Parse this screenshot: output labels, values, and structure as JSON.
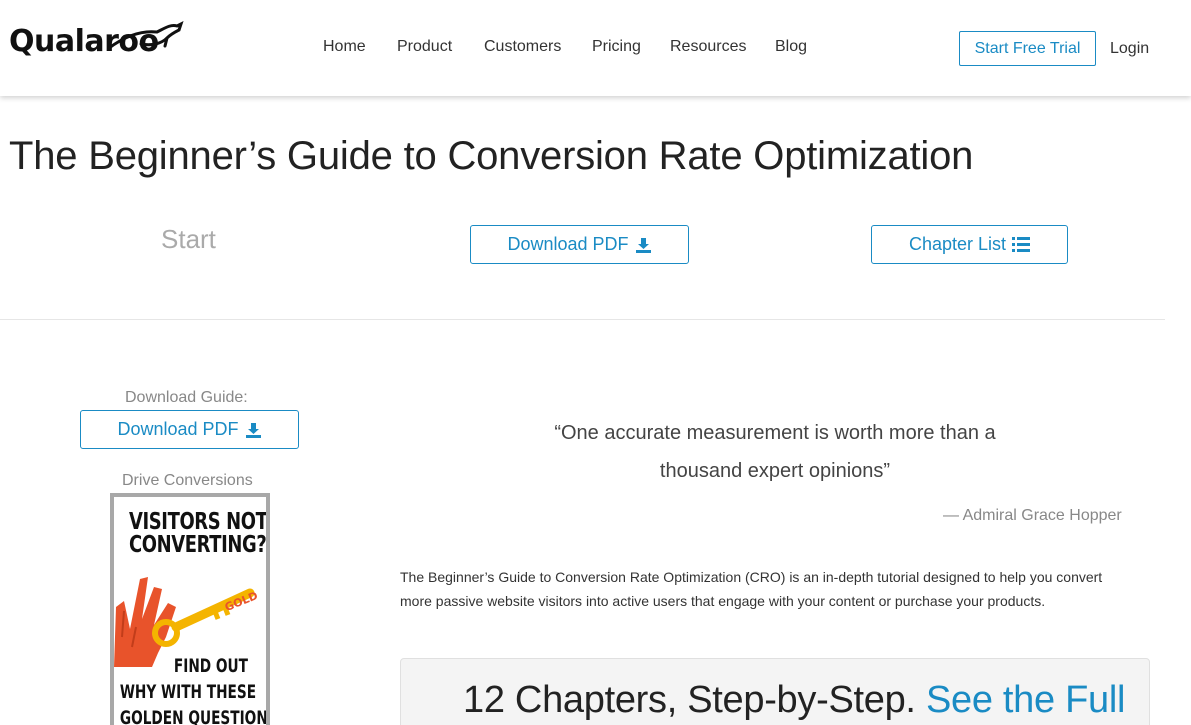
{
  "brand": {
    "logo_text": "Qualaroo",
    "accent_color": "#1a8bc4"
  },
  "nav": {
    "items": [
      {
        "label": "Home"
      },
      {
        "label": "Product"
      },
      {
        "label": "Customers"
      },
      {
        "label": "Pricing"
      },
      {
        "label": "Resources"
      },
      {
        "label": "Blog"
      }
    ],
    "trial_button": "Start Free Trial",
    "login": "Login"
  },
  "page": {
    "title": "The Beginner’s Guide to Conversion Rate Optimization",
    "start_label": "Start",
    "download_pdf_label": "Download PDF",
    "chapter_list_label": "Chapter List"
  },
  "sidebar": {
    "download_heading": "Download Guide:",
    "download_button": "Download PDF",
    "ad_heading": "Drive Conversions",
    "ad": {
      "headline_1": "VISITORS NOT",
      "headline_2": "CONVERTING?",
      "key_tag": "GOLD",
      "footer_1": "FIND OUT",
      "footer_2": "WHY WITH THESE",
      "footer_3": "GOLDEN QUESTIONS."
    }
  },
  "main": {
    "quote_line_1": "“One accurate measurement is worth more than a",
    "quote_line_2": "thousand expert opinions”",
    "attribution": "— Admiral Grace Hopper",
    "intro_line_1": "The Beginner’s Guide to Conversion Rate Optimization (CRO) is an in-depth tutorial designed to help you convert",
    "intro_line_2": "more passive website visitors into active users that engage with your content or purchase your products.",
    "chapters_text": "12 Chapters, Step-by-Step.",
    "chapters_link": "See the Full"
  },
  "icons": {
    "download": "download-icon",
    "chapter_list": "list-icon",
    "logo_mark": "kangaroo-icon"
  }
}
